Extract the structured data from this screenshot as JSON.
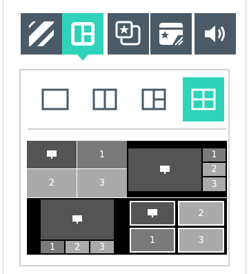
{
  "toolbar": {
    "buttons": [
      {
        "id": "stripes",
        "icon": "stripes-icon",
        "active": false
      },
      {
        "id": "layout",
        "icon": "layout-panels-icon",
        "active": true
      },
      {
        "id": "star-import",
        "icon": "star-square-icon",
        "active": false
      },
      {
        "id": "star-window",
        "icon": "star-window-icon",
        "active": false
      },
      {
        "id": "volume",
        "icon": "speaker-volume-icon",
        "active": false
      }
    ],
    "colors": {
      "default": "#4a5a66",
      "active": "#2ed3b9"
    }
  },
  "layout_options": [
    {
      "id": "single",
      "icon": "single-pane-icon",
      "selected": false
    },
    {
      "id": "split-two",
      "icon": "two-pane-icon",
      "selected": false
    },
    {
      "id": "split-three",
      "icon": "three-pane-icon",
      "selected": false
    },
    {
      "id": "quad",
      "icon": "quad-pane-icon",
      "selected": true
    }
  ],
  "previews": {
    "quad_grid": {
      "labels": [
        "1",
        "2",
        "3"
      ]
    },
    "main_plus_three_right": {
      "labels": [
        "1",
        "2",
        "3"
      ]
    },
    "main_plus_three_bottom": {
      "labels": [
        "1",
        "2",
        "3"
      ]
    },
    "bordered_quad": {
      "labels": [
        "2",
        "1",
        "3"
      ]
    }
  }
}
